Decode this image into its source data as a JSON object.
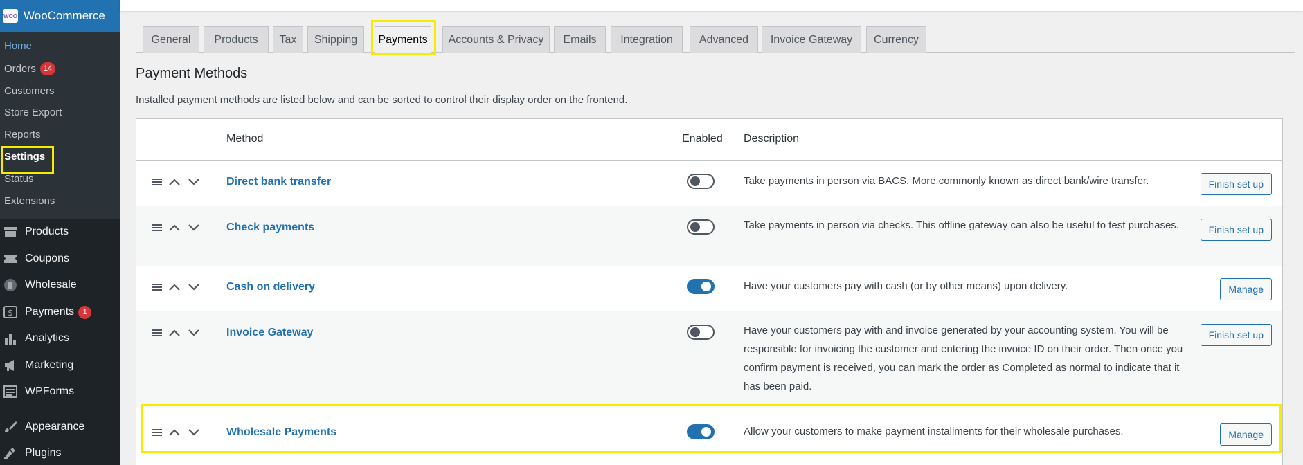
{
  "sidebar": {
    "brand": "WooCommerce",
    "brand_logo_text": "WOO",
    "submenu": [
      {
        "label": "Home"
      },
      {
        "label": "Orders",
        "badge": "14"
      },
      {
        "label": "Customers"
      },
      {
        "label": "Store Export"
      },
      {
        "label": "Reports"
      },
      {
        "label": "Settings"
      },
      {
        "label": "Status"
      },
      {
        "label": "Extensions"
      }
    ],
    "menu": [
      {
        "label": "Products",
        "icon": "archive-icon"
      },
      {
        "label": "Coupons",
        "icon": "ticket-icon"
      },
      {
        "label": "Wholesale",
        "icon": "wholesale-icon"
      },
      {
        "label": "Payments",
        "icon": "dollar-icon",
        "badge": "1"
      },
      {
        "label": "Analytics",
        "icon": "bar-chart-icon"
      },
      {
        "label": "Marketing",
        "icon": "megaphone-icon"
      },
      {
        "label": "WPForms",
        "icon": "forms-icon"
      },
      {
        "label": "Appearance",
        "icon": "paintbrush-icon"
      },
      {
        "label": "Plugins",
        "icon": "plug-icon"
      }
    ]
  },
  "tabs": [
    "General",
    "Products",
    "Tax",
    "Shipping",
    "Payments",
    "Accounts & Privacy",
    "Emails",
    "Integration",
    "Advanced",
    "Invoice Gateway",
    "Currency"
  ],
  "active_tab": "Payments",
  "page": {
    "heading": "Payment Methods",
    "description": "Installed payment methods are listed below and can be sorted to control their display order on the frontend."
  },
  "table": {
    "headers": {
      "method": "Method",
      "enabled": "Enabled",
      "description": "Description"
    },
    "rows": [
      {
        "method": "Direct bank transfer",
        "enabled": false,
        "description": "Take payments in person via BACS. More commonly known as direct bank/wire transfer.",
        "action": "Finish set up"
      },
      {
        "method": "Check payments",
        "enabled": false,
        "description": "Take payments in person via checks. This offline gateway can also be useful to test purchases.",
        "action": "Finish set up"
      },
      {
        "method": "Cash on delivery",
        "enabled": true,
        "description": "Have your customers pay with cash (or by other means) upon delivery.",
        "action": "Manage"
      },
      {
        "method": "Invoice Gateway",
        "enabled": false,
        "description": "Have your customers pay with and invoice generated by your accounting system. You will be responsible for invoicing the customer and entering the invoice ID on their order. Then once you confirm payment is received, you can mark the order as Completed as normal to indicate that it has been paid.",
        "action": "Finish set up"
      },
      {
        "method": "Wholesale Payments",
        "enabled": true,
        "description": "Allow your customers to make payment installments for their wholesale purchases.",
        "action": "Manage"
      }
    ]
  },
  "colors": {
    "accent": "#2271b1",
    "highlight": "#f5ec00",
    "badge": "#d63638",
    "sidebar": "#1d2327"
  }
}
